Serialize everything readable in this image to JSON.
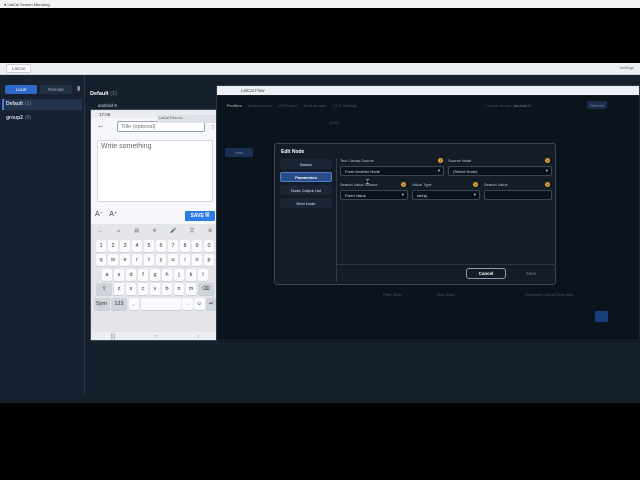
{
  "mac_bar": {
    "title": "LaiCai Screen Mirroring"
  },
  "window": {
    "tab": "LaiCai",
    "right_text": "Settings"
  },
  "left_panel": {
    "tabs": [
      {
        "label": "Local"
      },
      {
        "label": "Remote"
      }
    ],
    "groups": [
      {
        "name": "Default",
        "count": "(1)"
      },
      {
        "name": "group2",
        "count": "(0)"
      }
    ]
  },
  "device": {
    "group_title": "Default",
    "group_count": "(1)",
    "name": "android 9",
    "mini_bar": "LaiCai Flow no..."
  },
  "phone": {
    "time": "17:06",
    "title_placeholder": "Title (optional)",
    "body_placeholder": "Write something",
    "font_smaller": "A⁻",
    "font_larger": "A⁺",
    "save_label": "SAVE",
    "keyboard_rows": [
      [
        "1",
        "2",
        "3",
        "4",
        "5",
        "6",
        "7",
        "8",
        "9",
        "0"
      ],
      [
        "q",
        "w",
        "e",
        "r",
        "t",
        "y",
        "u",
        "i",
        "o",
        "p"
      ],
      [
        "a",
        "s",
        "d",
        "f",
        "g",
        "h",
        "j",
        "k",
        "l"
      ],
      [
        "⇧",
        "z",
        "x",
        "c",
        "v",
        "b",
        "n",
        "m",
        "⌫"
      ],
      [
        "Sym",
        "123",
        ",",
        "space",
        ".",
        "☺",
        "↵"
      ]
    ],
    "nav": [
      "|||",
      "○",
      "‹"
    ]
  },
  "app": {
    "title": "LaiCai Flow",
    "tabs": [
      "Profiles",
      "Saved Nodes",
      "UI Element",
      "Draft storage",
      "OCR Settings"
    ],
    "device_label": "Current Device:",
    "device_value": "android 9",
    "refresh_label": "Refresh",
    "new_label": "New",
    "zoom": "100%",
    "filter_label": "Filter Slots",
    "sort_label": "Sort Slots",
    "footer_hint": "Unnamed LaiCai Flow step"
  },
  "modal": {
    "title": "Edit Node",
    "nav": [
      "Basics",
      "Parameters",
      "Node Output List",
      "Next Node"
    ],
    "active_nav": "Parameters",
    "fields": {
      "text_source_label": "Text / Array Source",
      "text_source_value": "From Another Node",
      "source_node_label": "Source Node",
      "source_node_value": "(Select Node)",
      "search_value_source_label": "Search Value Source",
      "search_value_source_value": "Fixed Value",
      "value_type_label": "Value Type",
      "value_type_value": "string",
      "search_value_label": "Search Value",
      "search_value_value": ""
    },
    "cancel_label": "Cancel",
    "save_label": "Save"
  }
}
